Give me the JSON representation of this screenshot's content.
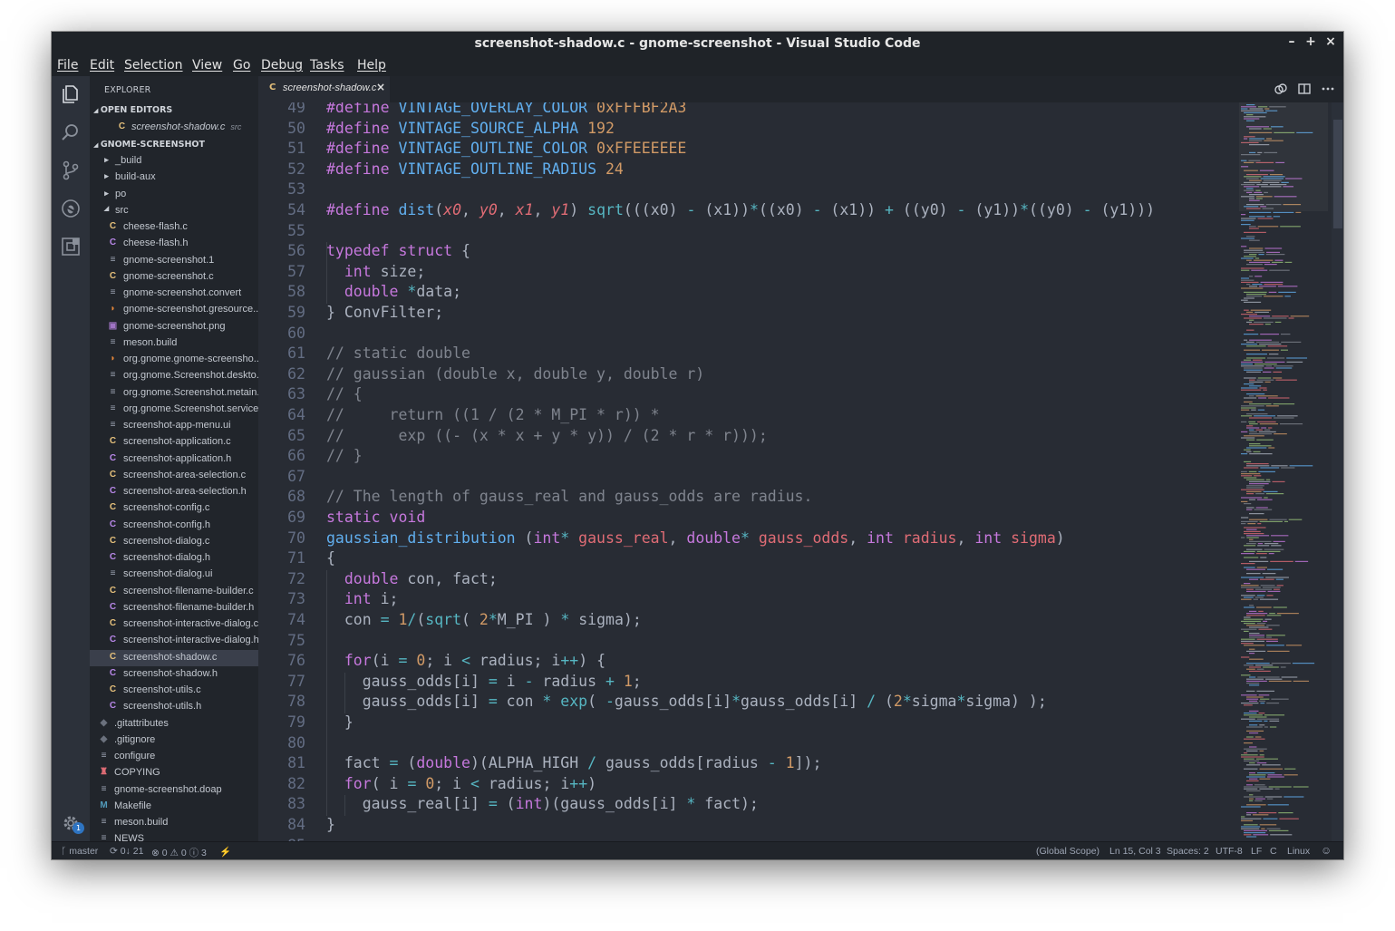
{
  "window": {
    "title": "screenshot-shadow.c - gnome-screenshot - Visual Studio Code",
    "minimize": "–",
    "maximize": "+",
    "close": "×"
  },
  "menu": [
    "File",
    "Edit",
    "Selection",
    "View",
    "Go",
    "Debug",
    "Tasks",
    "Help"
  ],
  "sidebar": {
    "title": "EXPLORER",
    "open_editors_label": "OPEN EDITORS",
    "open_editor": {
      "icon": "C",
      "name": "screenshot-shadow.c",
      "hint": "src"
    },
    "project_label": "GNOME-SCREENSHOT",
    "folders": [
      "_build",
      "build-aux",
      "po",
      "src"
    ],
    "src_files": [
      {
        "icon": "C",
        "name": "cheese-flash.c"
      },
      {
        "icon": "C+",
        "name": "cheese-flash.h"
      },
      {
        "icon": "≡",
        "name": "gnome-screenshot.1"
      },
      {
        "icon": "C",
        "name": "gnome-screenshot.c"
      },
      {
        "icon": "≡",
        "name": "gnome-screenshot.convert"
      },
      {
        "icon": "rss",
        "name": "gnome-screenshot.gresource..."
      },
      {
        "icon": "img",
        "name": "gnome-screenshot.png"
      },
      {
        "icon": "≡",
        "name": "meson.build"
      },
      {
        "icon": "rss",
        "name": "org.gnome.gnome-screensho..."
      },
      {
        "icon": "≡",
        "name": "org.gnome.Screenshot.deskto..."
      },
      {
        "icon": "≡",
        "name": "org.gnome.Screenshot.metain..."
      },
      {
        "icon": "≡",
        "name": "org.gnome.Screenshot.service..."
      },
      {
        "icon": "≡",
        "name": "screenshot-app-menu.ui"
      },
      {
        "icon": "C",
        "name": "screenshot-application.c"
      },
      {
        "icon": "C+",
        "name": "screenshot-application.h"
      },
      {
        "icon": "C",
        "name": "screenshot-area-selection.c"
      },
      {
        "icon": "C+",
        "name": "screenshot-area-selection.h"
      },
      {
        "icon": "C",
        "name": "screenshot-config.c"
      },
      {
        "icon": "C+",
        "name": "screenshot-config.h"
      },
      {
        "icon": "C",
        "name": "screenshot-dialog.c"
      },
      {
        "icon": "C+",
        "name": "screenshot-dialog.h"
      },
      {
        "icon": "≡",
        "name": "screenshot-dialog.ui"
      },
      {
        "icon": "C",
        "name": "screenshot-filename-builder.c"
      },
      {
        "icon": "C+",
        "name": "screenshot-filename-builder.h"
      },
      {
        "icon": "C",
        "name": "screenshot-interactive-dialog.c"
      },
      {
        "icon": "C+",
        "name": "screenshot-interactive-dialog.h"
      },
      {
        "icon": "C",
        "name": "screenshot-shadow.c"
      },
      {
        "icon": "C+",
        "name": "screenshot-shadow.h"
      },
      {
        "icon": "C",
        "name": "screenshot-utils.c"
      },
      {
        "icon": "C+",
        "name": "screenshot-utils.h"
      }
    ],
    "root_files": [
      {
        "icon": "◆",
        "name": ".gitattributes"
      },
      {
        "icon": "◆",
        "name": ".gitignore"
      },
      {
        "icon": "≡",
        "name": "configure"
      },
      {
        "icon": "person",
        "name": "COPYING"
      },
      {
        "icon": "≡",
        "name": "gnome-screenshot.doap"
      },
      {
        "icon": "M",
        "name": "Makefile"
      },
      {
        "icon": "≡",
        "name": "meson.build"
      },
      {
        "icon": "≡",
        "name": "NEWS"
      }
    ],
    "settings_badge": "1"
  },
  "tab": {
    "icon": "C",
    "label": "screenshot-shadow.c",
    "close": "×"
  },
  "editor": {
    "lines": [
      {
        "n": "49",
        "toks": [
          [
            "k",
            "#define "
          ],
          [
            "f",
            "VINTAGE_OVERLAY_COLOR "
          ],
          [
            "n",
            "0xFFFBF2A3"
          ]
        ]
      },
      {
        "n": "50",
        "toks": [
          [
            "k",
            "#define "
          ],
          [
            "f",
            "VINTAGE_SOURCE_ALPHA "
          ],
          [
            "n",
            "192"
          ]
        ]
      },
      {
        "n": "51",
        "toks": [
          [
            "k",
            "#define "
          ],
          [
            "f",
            "VINTAGE_OUTLINE_COLOR "
          ],
          [
            "n",
            "0xFFEEEEEE"
          ]
        ]
      },
      {
        "n": "52",
        "toks": [
          [
            "k",
            "#define "
          ],
          [
            "f",
            "VINTAGE_OUTLINE_RADIUS "
          ],
          [
            "n",
            "24"
          ]
        ]
      },
      {
        "n": "53",
        "toks": []
      },
      {
        "n": "54",
        "toks": [
          [
            "k",
            "#define "
          ],
          [
            "f",
            "dist"
          ],
          [
            "t",
            "("
          ],
          [
            "p",
            "x0"
          ],
          [
            "t",
            ", "
          ],
          [
            "p",
            "y0"
          ],
          [
            "t",
            ", "
          ],
          [
            "p",
            "x1"
          ],
          [
            "t",
            ", "
          ],
          [
            "p",
            "y1"
          ],
          [
            "t",
            ") "
          ],
          [
            "o",
            "sqrt"
          ],
          [
            "t",
            "(((x0) "
          ],
          [
            "o",
            "-"
          ],
          [
            "t",
            " (x1))"
          ],
          [
            "o",
            "*"
          ],
          [
            "t",
            "((x0) "
          ],
          [
            "o",
            "-"
          ],
          [
            "t",
            " (x1)) "
          ],
          [
            "o",
            "+"
          ],
          [
            "t",
            " ((y0) "
          ],
          [
            "o",
            "-"
          ],
          [
            "t",
            " (y1))"
          ],
          [
            "o",
            "*"
          ],
          [
            "t",
            "((y0) "
          ],
          [
            "o",
            "-"
          ],
          [
            "t",
            " (y1)))"
          ]
        ]
      },
      {
        "n": "55",
        "toks": []
      },
      {
        "n": "56",
        "toks": [
          [
            "k",
            "typedef struct "
          ],
          [
            "t",
            "{"
          ]
        ]
      },
      {
        "n": "57",
        "toks": [
          [
            "t",
            "  "
          ],
          [
            "k",
            "int "
          ],
          [
            "t",
            "size;"
          ]
        ]
      },
      {
        "n": "58",
        "toks": [
          [
            "t",
            "  "
          ],
          [
            "k",
            "double "
          ],
          [
            "o",
            "*"
          ],
          [
            "t",
            "data;"
          ]
        ]
      },
      {
        "n": "59",
        "toks": [
          [
            "t",
            "} ConvFilter;"
          ]
        ]
      },
      {
        "n": "60",
        "toks": []
      },
      {
        "n": "61",
        "toks": [
          [
            "c",
            "// static double"
          ]
        ]
      },
      {
        "n": "62",
        "toks": [
          [
            "c",
            "// gaussian (double x, double y, double r)"
          ]
        ]
      },
      {
        "n": "63",
        "toks": [
          [
            "c",
            "// {"
          ]
        ]
      },
      {
        "n": "64",
        "toks": [
          [
            "c",
            "//     return ((1 / (2 * M_PI * r)) *"
          ]
        ]
      },
      {
        "n": "65",
        "toks": [
          [
            "c",
            "//      exp ((- (x * x + y * y)) / (2 * r * r)));"
          ]
        ]
      },
      {
        "n": "66",
        "toks": [
          [
            "c",
            "// }"
          ]
        ]
      },
      {
        "n": "67",
        "toks": []
      },
      {
        "n": "68",
        "toks": [
          [
            "c",
            "// The length of gauss_real and gauss_odds are radius."
          ]
        ]
      },
      {
        "n": "69",
        "toks": [
          [
            "k",
            "static void"
          ]
        ]
      },
      {
        "n": "70",
        "toks": [
          [
            "f",
            "gaussian_distribution "
          ],
          [
            "t",
            "("
          ],
          [
            "k",
            "int"
          ],
          [
            "o",
            "* "
          ],
          [
            "v",
            "gauss_real"
          ],
          [
            "t",
            ", "
          ],
          [
            "k",
            "double"
          ],
          [
            "o",
            "* "
          ],
          [
            "v",
            "gauss_odds"
          ],
          [
            "t",
            ", "
          ],
          [
            "k",
            "int "
          ],
          [
            "v",
            "radius"
          ],
          [
            "t",
            ", "
          ],
          [
            "k",
            "int "
          ],
          [
            "v",
            "sigma"
          ],
          [
            "t",
            ")"
          ]
        ]
      },
      {
        "n": "71",
        "toks": [
          [
            "t",
            "{"
          ]
        ]
      },
      {
        "n": "72",
        "toks": [
          [
            "t",
            "  "
          ],
          [
            "k",
            "double "
          ],
          [
            "t",
            "con, fact;"
          ]
        ]
      },
      {
        "n": "73",
        "toks": [
          [
            "t",
            "  "
          ],
          [
            "k",
            "int "
          ],
          [
            "t",
            "i;"
          ]
        ]
      },
      {
        "n": "74",
        "toks": [
          [
            "t",
            "  con "
          ],
          [
            "o",
            "="
          ],
          [
            "t",
            " "
          ],
          [
            "n",
            "1"
          ],
          [
            "o",
            "/"
          ],
          [
            "t",
            "("
          ],
          [
            "o",
            "sqrt"
          ],
          [
            "t",
            "( "
          ],
          [
            "n",
            "2"
          ],
          [
            "o",
            "*"
          ],
          [
            "t",
            "M_PI ) "
          ],
          [
            "o",
            "*"
          ],
          [
            "t",
            " sigma);"
          ]
        ]
      },
      {
        "n": "75",
        "toks": []
      },
      {
        "n": "76",
        "toks": [
          [
            "t",
            "  "
          ],
          [
            "k",
            "for"
          ],
          [
            "t",
            "(i "
          ],
          [
            "o",
            "="
          ],
          [
            "t",
            " "
          ],
          [
            "n",
            "0"
          ],
          [
            "t",
            "; i "
          ],
          [
            "o",
            "<"
          ],
          [
            "t",
            " radius; i"
          ],
          [
            "o",
            "++"
          ],
          [
            "t",
            ") {"
          ]
        ]
      },
      {
        "n": "77",
        "toks": [
          [
            "t",
            "    gauss_odds[i] "
          ],
          [
            "o",
            "="
          ],
          [
            "t",
            " i "
          ],
          [
            "o",
            "-"
          ],
          [
            "t",
            " radius "
          ],
          [
            "o",
            "+"
          ],
          [
            "t",
            " "
          ],
          [
            "n",
            "1"
          ],
          [
            "t",
            ";"
          ]
        ]
      },
      {
        "n": "78",
        "toks": [
          [
            "t",
            "    gauss_odds[i] "
          ],
          [
            "o",
            "="
          ],
          [
            "t",
            " con "
          ],
          [
            "o",
            "*"
          ],
          [
            "t",
            " "
          ],
          [
            "o",
            "exp"
          ],
          [
            "t",
            "( "
          ],
          [
            "o",
            "-"
          ],
          [
            "t",
            "gauss_odds[i]"
          ],
          [
            "o",
            "*"
          ],
          [
            "t",
            "gauss_odds[i] "
          ],
          [
            "o",
            "/"
          ],
          [
            "t",
            " ("
          ],
          [
            "n",
            "2"
          ],
          [
            "o",
            "*"
          ],
          [
            "t",
            "sigma"
          ],
          [
            "o",
            "*"
          ],
          [
            "t",
            "sigma) );"
          ]
        ]
      },
      {
        "n": "79",
        "toks": [
          [
            "t",
            "  }"
          ]
        ]
      },
      {
        "n": "80",
        "toks": []
      },
      {
        "n": "81",
        "toks": [
          [
            "t",
            "  fact "
          ],
          [
            "o",
            "="
          ],
          [
            "t",
            " ("
          ],
          [
            "k",
            "double"
          ],
          [
            "t",
            ")(ALPHA_HIGH "
          ],
          [
            "o",
            "/"
          ],
          [
            "t",
            " gauss_odds[radius "
          ],
          [
            "o",
            "-"
          ],
          [
            "t",
            " "
          ],
          [
            "n",
            "1"
          ],
          [
            "t",
            "]);"
          ]
        ]
      },
      {
        "n": "82",
        "toks": [
          [
            "t",
            "  "
          ],
          [
            "k",
            "for"
          ],
          [
            "t",
            "( i "
          ],
          [
            "o",
            "="
          ],
          [
            "t",
            " "
          ],
          [
            "n",
            "0"
          ],
          [
            "t",
            "; i "
          ],
          [
            "o",
            "<"
          ],
          [
            "t",
            " radius; i"
          ],
          [
            "o",
            "++"
          ],
          [
            "t",
            ")"
          ]
        ]
      },
      {
        "n": "83",
        "toks": [
          [
            "t",
            "    gauss_real[i] "
          ],
          [
            "o",
            "="
          ],
          [
            "t",
            " ("
          ],
          [
            "k",
            "int"
          ],
          [
            "t",
            ")(gauss_odds[i] "
          ],
          [
            "o",
            "*"
          ],
          [
            "t",
            " fact);"
          ]
        ]
      },
      {
        "n": "84",
        "toks": [
          [
            "t",
            "}"
          ]
        ]
      },
      {
        "n": "85",
        "toks": []
      }
    ]
  },
  "status": {
    "branch": "master",
    "sync": "0↓ 21",
    "errors": "0",
    "warnings": "0",
    "infos": "3",
    "lightning": "⚡",
    "scope": "(Global Scope)",
    "position": "Ln 15, Col 3",
    "spaces": "Spaces: 2",
    "encoding": "UTF-8",
    "eol": "LF",
    "language": "C",
    "platform": "Linux"
  },
  "colors": {
    "keyword": "#c678dd",
    "string": "#98c379",
    "number": "#d19a66",
    "comment": "#7f848e",
    "function": "#61afef",
    "param": "#e06c75",
    "operator": "#56b6c2",
    "text": "#abb2bf",
    "c_icon": "#e5c07b",
    "h_icon": "#b887e8"
  }
}
